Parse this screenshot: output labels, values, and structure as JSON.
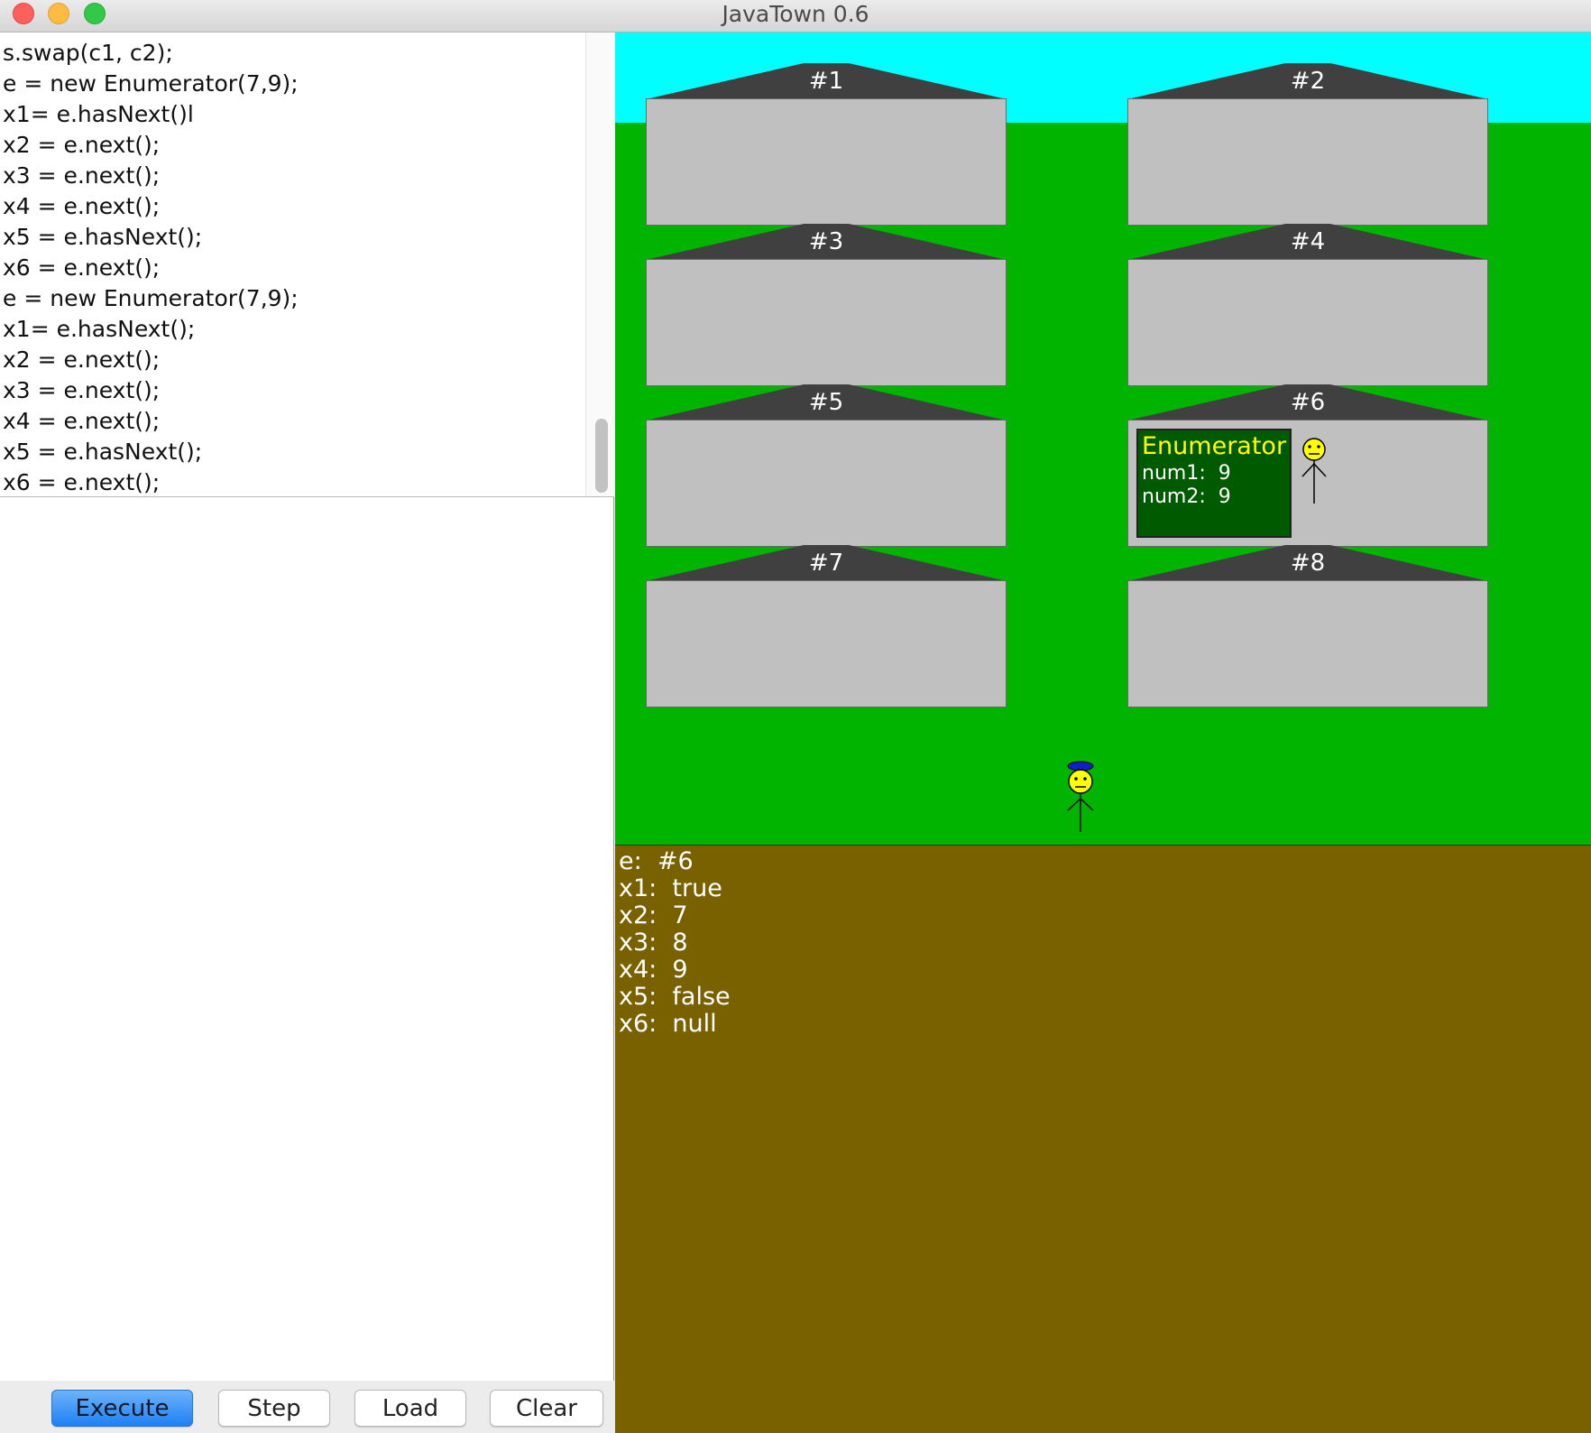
{
  "window": {
    "title": "JavaTown 0.6",
    "controls": [
      "close",
      "minimize",
      "maximize"
    ]
  },
  "editor": {
    "lines": [
      "s.swap(c1, c2);",
      "e = new Enumerator(7,9);",
      "x1= e.hasNext()l",
      "x2 = e.next();",
      "x3 = e.next();",
      "x4 = e.next();",
      "x5 = e.hasNext();",
      "x6 = e.next();",
      "e = new Enumerator(7,9);",
      "x1= e.hasNext();",
      "x2 = e.next();",
      "x3 = e.next();",
      "x4 = e.next();",
      "x5 = e.hasNext();",
      "x6 = e.next();"
    ]
  },
  "buttons": {
    "execute": "Execute",
    "step": "Step",
    "load": "Load",
    "clear": "Clear"
  },
  "town": {
    "colors": {
      "sky": "#00ffff",
      "grass": "#00b400",
      "roof": "#404040",
      "house": "#c0c0c0"
    },
    "houses": [
      {
        "label": "#1"
      },
      {
        "label": "#2"
      },
      {
        "label": "#3"
      },
      {
        "label": "#4"
      },
      {
        "label": "#5"
      },
      {
        "label": "#6"
      },
      {
        "label": "#7"
      },
      {
        "label": "#8"
      }
    ],
    "object": {
      "house": "#6",
      "class_name": "Enumerator",
      "fields": [
        "num1:  9",
        "num2:  9"
      ]
    },
    "people": [
      {
        "name": "object-resident",
        "icon": "stick-figure-icon",
        "location": "house #6"
      },
      {
        "name": "walker",
        "icon": "stick-figure-with-cap-icon",
        "location": "street"
      }
    ]
  },
  "variables": {
    "lines": [
      "e:  #6",
      "x1:  true",
      "x2:  7",
      "x3:  8",
      "x4:  9",
      "x5:  false",
      "x6:  null"
    ]
  }
}
